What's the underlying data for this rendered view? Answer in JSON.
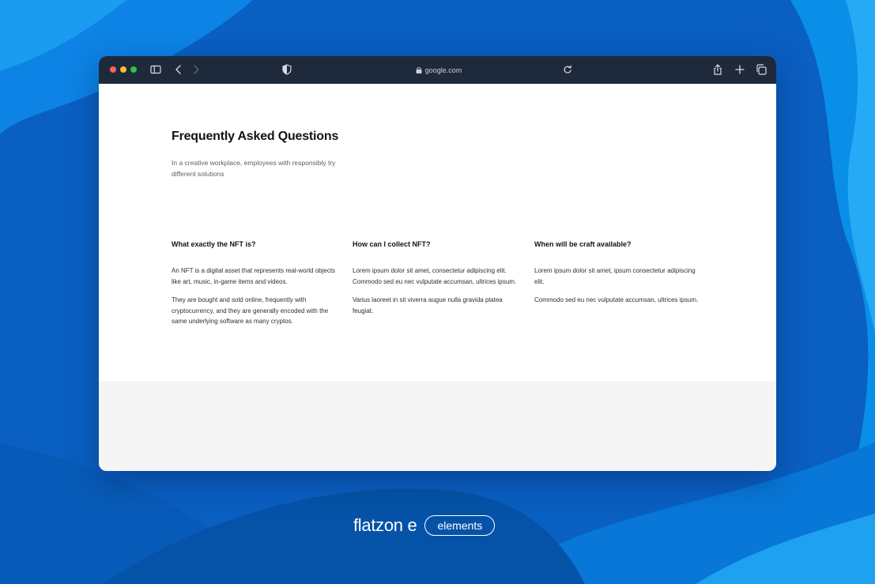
{
  "browser": {
    "url": "google.com"
  },
  "faq": {
    "title": "Frequently Asked Questions",
    "subtitle": "In a creative workplace, employees with responsibly try different solutions",
    "columns": [
      {
        "question": "What exactly the NFT is?",
        "answers": [
          "An NFT is a digital asset that represents real-world objects like art, music, in-game items and videos.",
          "They are bought and sold online, frequently with cryptocurrency, and they are generally encoded with the same underlying software as many cryptos."
        ]
      },
      {
        "question": "How can I collect NFT?",
        "answers": [
          "Lorem ipsum dolor sit amet, consectetur adipiscing elit. Commodo sed eu nec vulputate accumsan, ultrices ipsum.",
          "Varius laoreet in sit viverra augue nulla gravida platea feugiat."
        ]
      },
      {
        "question": "When will be craft available?",
        "answers": [
          "Lorem ipsum dolor sit amet, ipsum consectetur adipiscing elit.",
          "Commodo sed eu nec vulputate accumsan, ultrices ipsum."
        ]
      }
    ]
  },
  "branding": {
    "name": "flatzon e",
    "tag": "elements"
  },
  "icons": {
    "close": "close-window-icon",
    "minimize": "minimize-window-icon",
    "zoom": "zoom-window-icon",
    "sidebar": "sidebar-icon",
    "back": "chevron-left-icon",
    "forward": "chevron-right-icon",
    "shield": "shield-icon",
    "lock": "lock-icon",
    "reload": "reload-icon",
    "share": "share-icon",
    "new_tab": "plus-icon",
    "tabs": "tabs-overview-icon"
  },
  "colors": {
    "background": "#0a5fc2",
    "titlebar": "#1e2a3b",
    "footer_area": "#f5f5f6"
  }
}
